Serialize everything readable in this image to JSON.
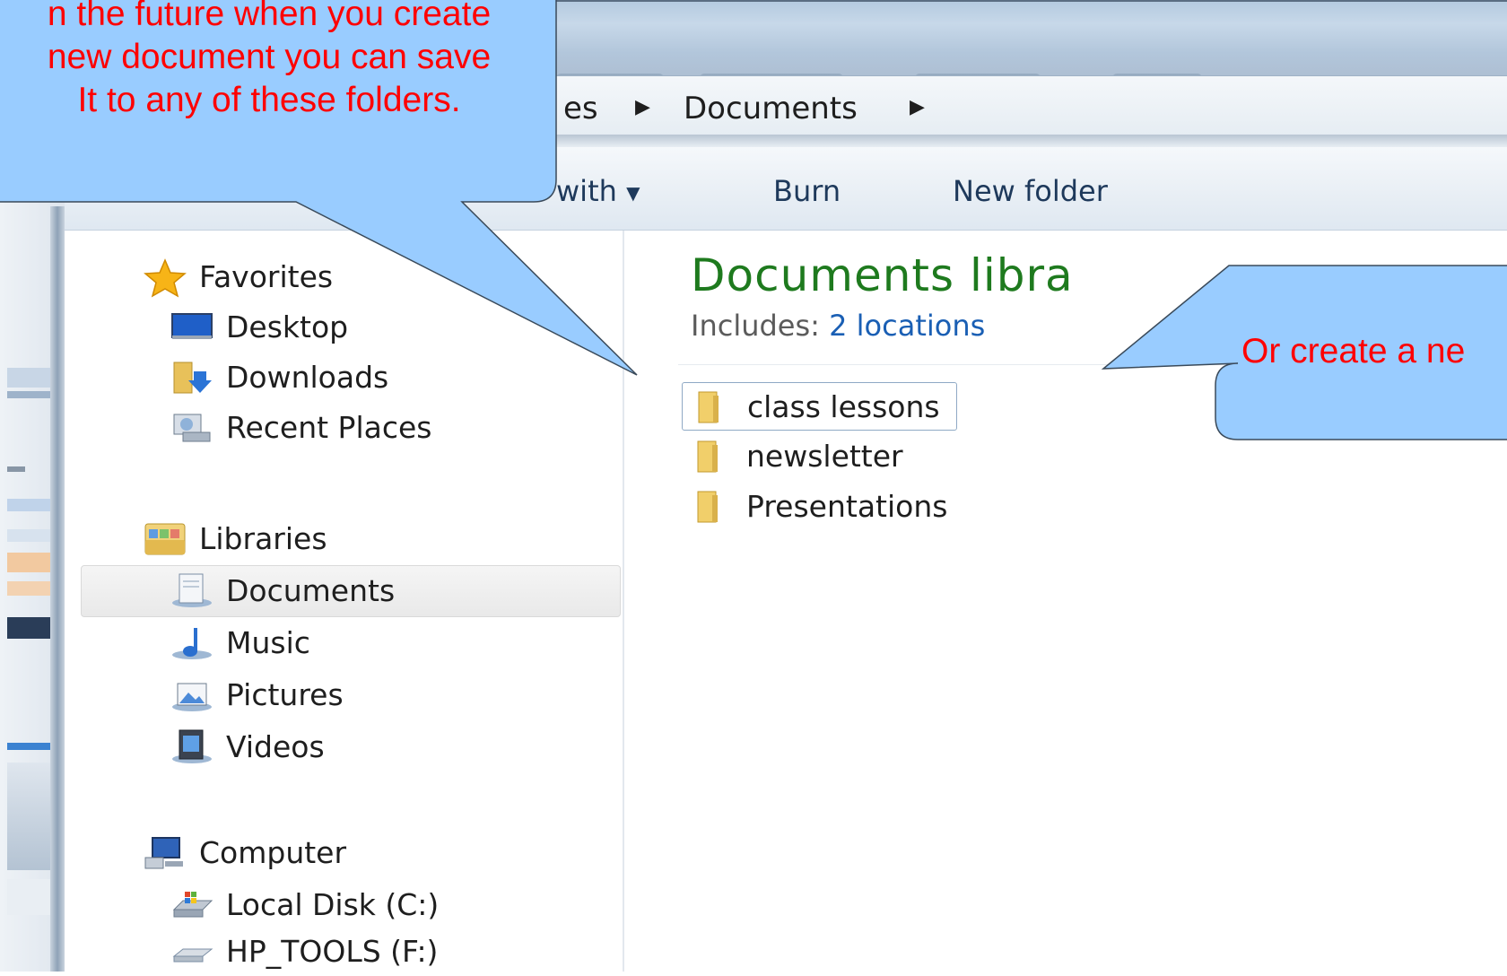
{
  "address_bar": {
    "crumb_partial": "es",
    "crumb_current": "Documents"
  },
  "toolbar": {
    "share_with_partial": "with",
    "burn": "Burn",
    "new_folder": "New folder"
  },
  "nav": {
    "favorites": "Favorites",
    "desktop": "Desktop",
    "downloads": "Downloads",
    "recent_places": "Recent Places",
    "libraries": "Libraries",
    "documents": "Documents",
    "music": "Music",
    "pictures": "Pictures",
    "videos": "Videos",
    "computer": "Computer",
    "local_disk": "Local Disk (C:)",
    "hp_tools": "HP_TOOLS (F:)"
  },
  "content": {
    "library_title": "Documents libra",
    "includes_label": "Includes:",
    "includes_link": "2 locations",
    "folders": [
      "class lessons",
      "newsletter",
      "Presentations"
    ]
  },
  "callouts": {
    "left_line1": "n the future when you create",
    "left_line2": "new document you can save",
    "left_line3": "It to any of these folders.",
    "right_text": "Or create a ne"
  },
  "colors": {
    "callout_fill": "#99ccff",
    "callout_text": "#ff0000",
    "library_title": "#1e7a1e",
    "link": "#1a5fb4"
  }
}
